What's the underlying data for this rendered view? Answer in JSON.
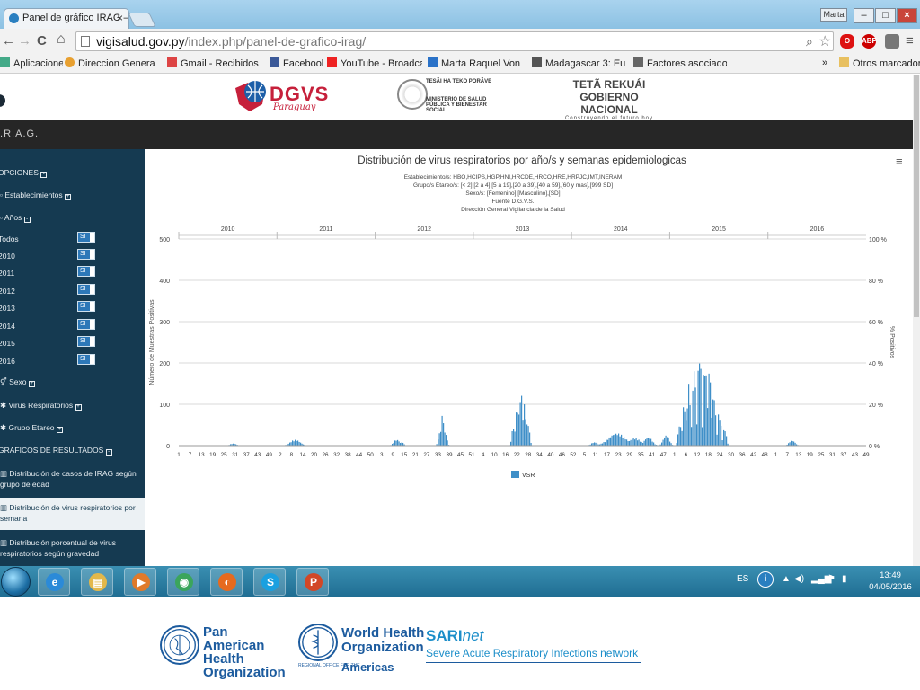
{
  "browser": {
    "tab_title": "Panel de gráfico IRAG – D",
    "tab_close": "×",
    "window_user": "Marta",
    "window_buttons": {
      "minimize": "–",
      "maximize": "□",
      "close": "×"
    },
    "url_host": "vigisalud.gov.py",
    "url_path": "/index.php/panel-de-grafico-irag/",
    "nav": {
      "back": "←",
      "forward": "→",
      "reload": "C",
      "home": "⌂"
    },
    "extensions": [
      {
        "name": "opera-icon",
        "label": "O",
        "color": "#d11"
      },
      {
        "name": "adblock-icon",
        "label": "ABP",
        "color": "#c00"
      },
      {
        "name": "extension-icon",
        "label": "",
        "color": "#777"
      }
    ],
    "bookmarks": [
      {
        "label": "Aplicaciones",
        "icon": "apps-icon",
        "color": "#4a8"
      },
      {
        "label": "Direccion General de",
        "icon": "globe-icon",
        "color": "#e8a030"
      },
      {
        "label": "Gmail - Recibidos (3.2",
        "icon": "gmail-icon",
        "color": "#d44"
      },
      {
        "label": "Facebook",
        "icon": "facebook-icon",
        "color": "#3b5998"
      },
      {
        "label": "YouTube - Broadcast",
        "icon": "youtube-icon",
        "color": "#e22"
      },
      {
        "label": "Marta Raquel Von Ho",
        "icon": "outlook-icon",
        "color": "#2a72c8"
      },
      {
        "label": "Madagascar 3: Europ",
        "icon": "film-icon",
        "color": "#555"
      },
      {
        "label": "Factores asociados a",
        "icon": "scholar-icon",
        "color": "#666"
      }
    ],
    "bookmarks_more": "»",
    "other_bookmarks": "Otros marcadores"
  },
  "header": {
    "dgvs_logo": "DGVS",
    "dgvs_sub": "Paraguay",
    "msp_line1": "TESÃI HA TEKO PORÃVE",
    "msp_line2": "MINISTERIO DE SALUD PÚBLICA Y BIENESTAR SOCIAL",
    "gob_line1": "TETÃ REKUÁI",
    "gob_line2": "GOBIERNO NACIONAL",
    "gob_line3": "Construyendo el futuro hoy"
  },
  "band": {
    "title": "I.R.A.G."
  },
  "sidebar": {
    "opciones": "OPCIONES",
    "establecimientos": "Establecimientos",
    "anios": "Años",
    "year_items": [
      {
        "label": "Todos",
        "toggle": "SI"
      },
      {
        "label": "2010",
        "toggle": "SI"
      },
      {
        "label": "2011",
        "toggle": "SI"
      },
      {
        "label": "2012",
        "toggle": "SI"
      },
      {
        "label": "2013",
        "toggle": "SI"
      },
      {
        "label": "2014",
        "toggle": "SI"
      },
      {
        "label": "2015",
        "toggle": "SI"
      },
      {
        "label": "2016",
        "toggle": "SI"
      }
    ],
    "sexo": "Sexo",
    "virus": "Virus Respiratorios",
    "grupo": "Grupo Etareo",
    "graficos": "GRAFICOS DE RESULTADOS",
    "links": [
      "Distribución de casos de IRAG según grupo de edad",
      "Distribución de virus respiratorios por semana",
      "Distribución porcentual de virus respiratorios según gravedad"
    ]
  },
  "chart": {
    "title": "Distribución de virus respiratorios por año/s y semanas epidemiologicas",
    "subtitle_lines": [
      "Establecimiento/s: HBO,HCIPS,HGP,HNI,HRCDE,HRCO,HRE,HRPJC,IMT,INERAM",
      "Grupo/s Etareo/s: [< 2],[2 a 4],[5 a 19],[20 a 39],[40 a 59],[60 y mas],[999 SD]",
      "Sexo/s: [Femenino],[Masculino],[SD]",
      "Fuente D.G.V.S.",
      "Dirección General Vigilancia de la Salud"
    ],
    "menu_icon": "≡"
  },
  "chart_data": {
    "type": "bar",
    "title": "Distribución de virus respiratorios por año/s y semanas epidemiologicas",
    "ylabel": "Número de Muestras Positivas",
    "y2label": "% Positivos",
    "ylim": [
      0,
      500
    ],
    "yticks": [
      0,
      100,
      200,
      300,
      400,
      500
    ],
    "y2ticks": [
      "0 %",
      "20 %",
      "40 %",
      "60 %",
      "80 %",
      "100 %"
    ],
    "years": [
      "2010",
      "2011",
      "2012",
      "2013",
      "2014",
      "2015",
      "2016"
    ],
    "xticks": [
      "1",
      "7",
      "13",
      "19",
      "25",
      "31",
      "37",
      "43",
      "49",
      "2",
      "8",
      "14",
      "20",
      "26",
      "32",
      "38",
      "44",
      "50",
      "3",
      "9",
      "15",
      "21",
      "27",
      "33",
      "39",
      "45",
      "51",
      "4",
      "10",
      "16",
      "22",
      "28",
      "34",
      "40",
      "46",
      "52",
      "5",
      "11",
      "17",
      "23",
      "29",
      "35",
      "41",
      "47",
      "1",
      "6",
      "12",
      "18",
      "24",
      "30",
      "36",
      "42",
      "48",
      "1",
      "7",
      "13",
      "19",
      "25",
      "31",
      "37",
      "43",
      "49"
    ],
    "legend": [
      "VSR"
    ],
    "series": [
      {
        "name": "VSR",
        "color": "#3f8fc8",
        "values": [
          0,
          0,
          0,
          0,
          0,
          0,
          0,
          0,
          0,
          0,
          0,
          0,
          0,
          0,
          0,
          0,
          0,
          0,
          0,
          0,
          0,
          0,
          0,
          0,
          0,
          0,
          0,
          0,
          0,
          0,
          0,
          0,
          0,
          0,
          0,
          0,
          0,
          0,
          0,
          0,
          0,
          0,
          0,
          0,
          0,
          0,
          0,
          0,
          2,
          3,
          5,
          4,
          5,
          6,
          4,
          3,
          2,
          1,
          0,
          0,
          0,
          0,
          0,
          0,
          0,
          0,
          0,
          0,
          0,
          0,
          0,
          0,
          0,
          0,
          0,
          0,
          0,
          0,
          0,
          0,
          0,
          0,
          0,
          0,
          0,
          0,
          0,
          0,
          0,
          0,
          0,
          0,
          0,
          0,
          0,
          0,
          0,
          0,
          0,
          0,
          0,
          0,
          0,
          0,
          0,
          0,
          0,
          0,
          0,
          0,
          0,
          0,
          0,
          0,
          0,
          0,
          0,
          0,
          0,
          0,
          0,
          2,
          4,
          6,
          8,
          10,
          12,
          14,
          16,
          15,
          12,
          10,
          8,
          6,
          4,
          3,
          2,
          1,
          0,
          0,
          0,
          0,
          0,
          0,
          0,
          0,
          0,
          0,
          0,
          0,
          0,
          0,
          0,
          0,
          0,
          0,
          0,
          0,
          0,
          0,
          0,
          0,
          0,
          0,
          0,
          0,
          0,
          0,
          0,
          0,
          0,
          0,
          0,
          0,
          0,
          0,
          0,
          0,
          0,
          0,
          0,
          0,
          0,
          0,
          0,
          0,
          0,
          0,
          0,
          0,
          0,
          0,
          0,
          0,
          0,
          0,
          0,
          0,
          0,
          0,
          0,
          0,
          0,
          0,
          0,
          0,
          0,
          0,
          0,
          0,
          0,
          0,
          0,
          0,
          0,
          0,
          0,
          0,
          0,
          0,
          0,
          0,
          0,
          0,
          0,
          0,
          0,
          0,
          0,
          0,
          0,
          0,
          0,
          0,
          0,
          0,
          0,
          0,
          0,
          0,
          0,
          0,
          0,
          0,
          0,
          0,
          0,
          0,
          0,
          0,
          0,
          0,
          0,
          0,
          0,
          0,
          0,
          0,
          0,
          0,
          0,
          0,
          0,
          0,
          0,
          0,
          0,
          0,
          0,
          0,
          0,
          0,
          0,
          0,
          0,
          0,
          0,
          0,
          0,
          0,
          0,
          0,
          0,
          0,
          0,
          0,
          0,
          0,
          0,
          0,
          0,
          0,
          0,
          0,
          0,
          0,
          0,
          0,
          0,
          0,
          0,
          0,
          0,
          0,
          0,
          0,
          0,
          0,
          0,
          0,
          0,
          0,
          0,
          0,
          0,
          0,
          0,
          0,
          0,
          0,
          0,
          0,
          0,
          0,
          0,
          0,
          0,
          0,
          0,
          0,
          0,
          0,
          0,
          0,
          0,
          0,
          0,
          0,
          0,
          0,
          0,
          0,
          0,
          0,
          0,
          0,
          0,
          0,
          0,
          0,
          0,
          0,
          0,
          0,
          0,
          0,
          0,
          0,
          0,
          0,
          0,
          0,
          0,
          0,
          0,
          0,
          0,
          0,
          0,
          0,
          0,
          0,
          0,
          0,
          0,
          0,
          0,
          0,
          0,
          0,
          0,
          0,
          0,
          0,
          0,
          0,
          0,
          0,
          0,
          0,
          0,
          0,
          0
        ]
      }
    ]
  },
  "taskbar": {
    "apps": [
      {
        "name": "ie-icon",
        "label": "e",
        "color": "#2b8ad8"
      },
      {
        "name": "explorer-icon",
        "label": "▤",
        "color": "#e3b84a"
      },
      {
        "name": "media-player-icon",
        "label": "▶",
        "color": "#e07a2a"
      },
      {
        "name": "chrome-icon",
        "label": "◉",
        "color": "#3ba55c"
      },
      {
        "name": "firefox-icon",
        "label": "◐",
        "color": "#e66a1f"
      },
      {
        "name": "skype-icon",
        "label": "S",
        "color": "#1aa0e0"
      },
      {
        "name": "powerpoint-icon",
        "label": "P",
        "color": "#d24726"
      }
    ],
    "lang": "ES",
    "time": "13:49",
    "date": "04/05/2016"
  },
  "footer": {
    "paho": "Pan American Health Organization",
    "who": "World Health Organization",
    "who_region": "REGIONAL OFFICE FOR THE",
    "who_americas": "Americas",
    "sari_title": "SARI",
    "sari_net": "net",
    "sari_sub": "Severe Acute Respiratory Infections network"
  }
}
